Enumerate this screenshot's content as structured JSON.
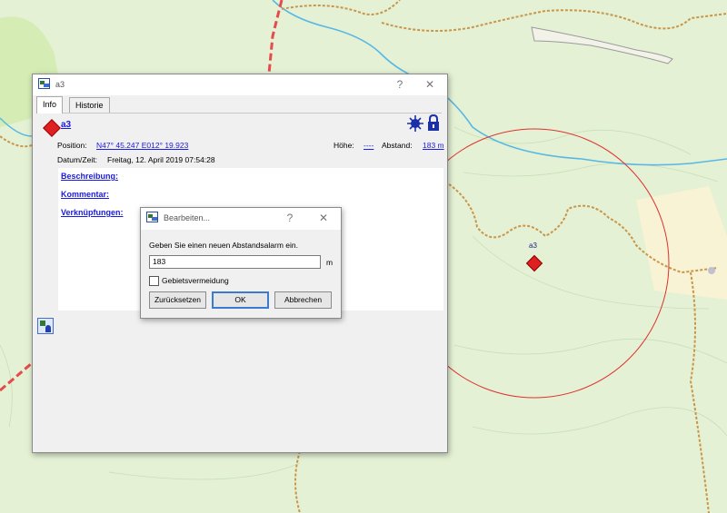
{
  "info_window": {
    "title": "a3",
    "help_symbol": "?",
    "close_symbol": "✕",
    "tabs": [
      {
        "label": "Info"
      },
      {
        "label": "Historie"
      }
    ],
    "waypoint_name": "a3",
    "position_label": "Position:",
    "position_value": "N47° 45.247 E012° 19.923",
    "hoehe_label": "Höhe:",
    "hoehe_value": "----",
    "abstand_label": "Abstand:",
    "abstand_value": "183 m",
    "datum_label": "Datum/Zeit:",
    "datum_value": "Freitag, 12. April 2019 07:54:28",
    "beschreibung_label": "Beschreibung:",
    "kommentar_label": "Kommentar:",
    "verknuepfungen_label": "Verknüpfungen:"
  },
  "edit_dialog": {
    "title": "Bearbeiten...",
    "help_symbol": "?",
    "close_symbol": "✕",
    "prompt": "Geben Sie einen neuen Abstandsalarm ein.",
    "value": "183",
    "unit": "m",
    "checkbox_label": "Gebietsvermeidung",
    "checkbox_checked": false,
    "reset_label": "Zurücksetzen",
    "ok_label": "OK",
    "cancel_label": "Abbrechen"
  },
  "map": {
    "waypoint_label": "a3",
    "alarm_circle_color": "#e03030",
    "annotation_color": "#e00000"
  }
}
